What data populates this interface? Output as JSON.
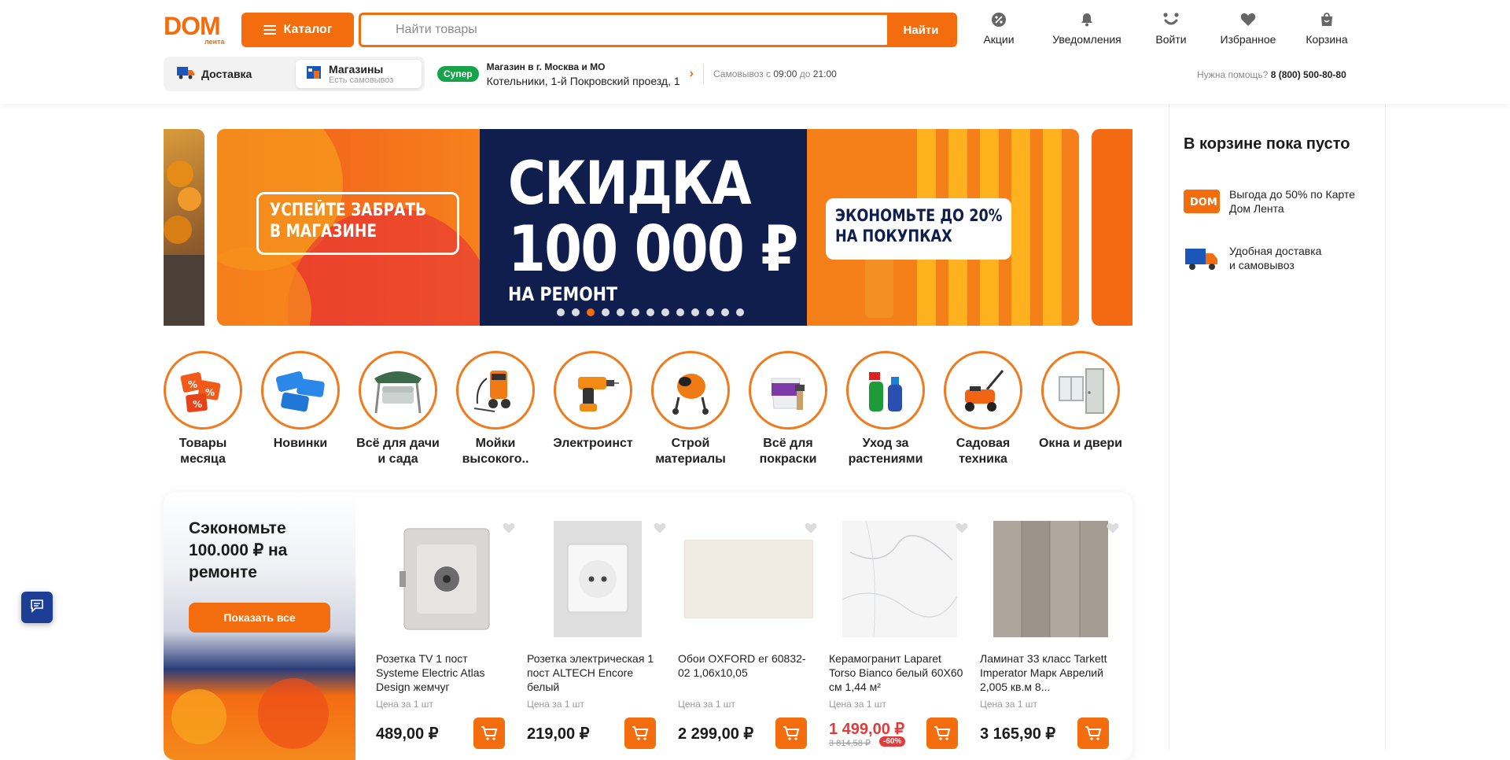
{
  "header": {
    "logo_text": "DOM",
    "logo_sub": "лента",
    "catalog_label": "Каталог",
    "search_placeholder": "Найти товары",
    "search_button": "Найти",
    "nav": [
      {
        "label": "Акции",
        "icon": "percent-icon"
      },
      {
        "label": "Уведомления",
        "icon": "bell-icon"
      },
      {
        "label": "Войти",
        "icon": "user-icon"
      },
      {
        "label": "Избранное",
        "icon": "heart-icon"
      },
      {
        "label": "Корзина",
        "icon": "bag-icon"
      }
    ]
  },
  "subbar": {
    "delivery_label": "Доставка",
    "stores_label": "Магазины",
    "stores_sub": "Есть самовывоз",
    "badge": "Супер",
    "store_city": "Магазин в г. Москва и МО",
    "store_address": "Котельники, 1-й Покровский проезд, 1",
    "pickup_prefix": "Самовывоз с",
    "pickup_from": "09:00",
    "pickup_mid": "до",
    "pickup_to": "21:00",
    "help_label": "Нужна помощь?",
    "help_phone": "8 (800) 500-80-80"
  },
  "banner": {
    "left_text_1": "УСПЕЙТЕ ЗАБРАТЬ",
    "left_text_2": "В МАГАЗИНЕ",
    "headline_1": "СКИДКА",
    "headline_2": "100 000 ₽",
    "headline_3": "НА РЕМОНТ",
    "right_text_1": "ЭКОНОМЬТЕ ДО 20%",
    "right_text_2": "НА ПОКУПКАХ",
    "slides_total": 13,
    "active_slide": 3
  },
  "categories": [
    {
      "name": "Товары месяца",
      "icon": "tags-icon"
    },
    {
      "name": "Новинки",
      "icon": "new-badges-icon"
    },
    {
      "name": "Всё для дачи и сада",
      "icon": "garden-swing-icon"
    },
    {
      "name": "Мойки высокого..",
      "icon": "pressure-washer-icon"
    },
    {
      "name": "Электроинст",
      "icon": "drill-icon"
    },
    {
      "name": "Строй материалы",
      "icon": "concrete-mixer-icon"
    },
    {
      "name": "Всё для покраски",
      "icon": "paint-bucket-icon"
    },
    {
      "name": "Уход за растениями",
      "icon": "plant-care-icon"
    },
    {
      "name": "Садовая техника",
      "icon": "lawn-mower-icon"
    },
    {
      "name": "Окна и двери",
      "icon": "window-door-icon"
    }
  ],
  "promo": {
    "title": "Сэкономьте 100.000 ₽ на ремонте",
    "show_all": "Показать все"
  },
  "products": [
    {
      "name": "Розетка TV 1 пост Systeme Electric Atlas Design жемчуг",
      "unit": "Цена за 1 шт",
      "price": "489,00 ₽"
    },
    {
      "name": "Розетка электрическая 1 пост ALTECH Encore белый",
      "unit": "Цена за 1 шт",
      "price": "219,00 ₽"
    },
    {
      "name": "Обои OXFORD ег 60832-02 1,06x10,05",
      "unit": "Цена за 1 шт",
      "price": "2 299,00 ₽"
    },
    {
      "name": "Керамогранит Laparet Torso Bianco белый 60X60 см 1,44 м²",
      "unit": "Цена за 1 шт",
      "price": "1 499,00 ₽",
      "old_price": "3 814,58 ₽",
      "discount": "-60%"
    },
    {
      "name": "Ламинат 33 класс Tarkett Imperator Марк Аврелий 2,005 кв.м 8...",
      "unit": "Цена за 1 шт",
      "price": "3 165,90 ₽"
    }
  ],
  "cart_panel": {
    "title": "В корзине пока пусто",
    "row1": "Выгода до 50% по Карте Дом Лента",
    "row2_a": "Удобная доставка",
    "row2_b": "и самовывоз"
  },
  "colors": {
    "accent": "#f36c0d",
    "banner_navy": "#0f1e4d",
    "sale_red": "#e33a3a",
    "badge_green": "#17a34a"
  }
}
